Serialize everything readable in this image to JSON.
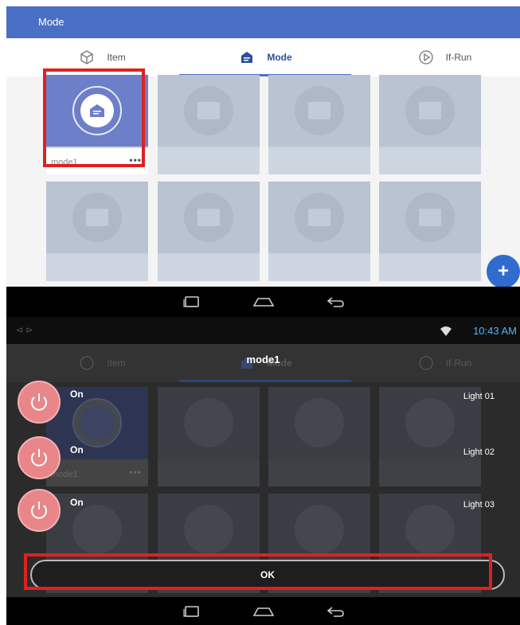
{
  "top_screen": {
    "appbar_title": "Mode",
    "tabs": [
      {
        "label": "Item",
        "icon": "cube-icon"
      },
      {
        "label": "Mode",
        "icon": "mode-house-icon"
      },
      {
        "label": "If-Run",
        "icon": "play-circle-icon"
      }
    ],
    "active_tab": "Mode",
    "tiles": [
      {
        "label": "mode1",
        "menu": "•••"
      }
    ],
    "fab_label": "+"
  },
  "bottom_screen": {
    "status_time": "10:43 AM",
    "dialog_title": "mode1",
    "tabs": [
      {
        "label": "Item"
      },
      {
        "label": "Mode"
      },
      {
        "label": "If-Run"
      }
    ],
    "tile_label": "mode1",
    "tile_menu": "•••",
    "rows": [
      {
        "state": "On",
        "light": "Light 01"
      },
      {
        "state": "On",
        "light": "Light 02"
      },
      {
        "state": "On",
        "light": "Light 03"
      }
    ],
    "ok_label": "OK"
  },
  "colors": {
    "appbar": "#4a6fc4",
    "accent_red": "#e02020",
    "power_pink": "#e8868a",
    "fab_blue": "#2f6ccd",
    "time_blue": "#4fb3ff"
  }
}
